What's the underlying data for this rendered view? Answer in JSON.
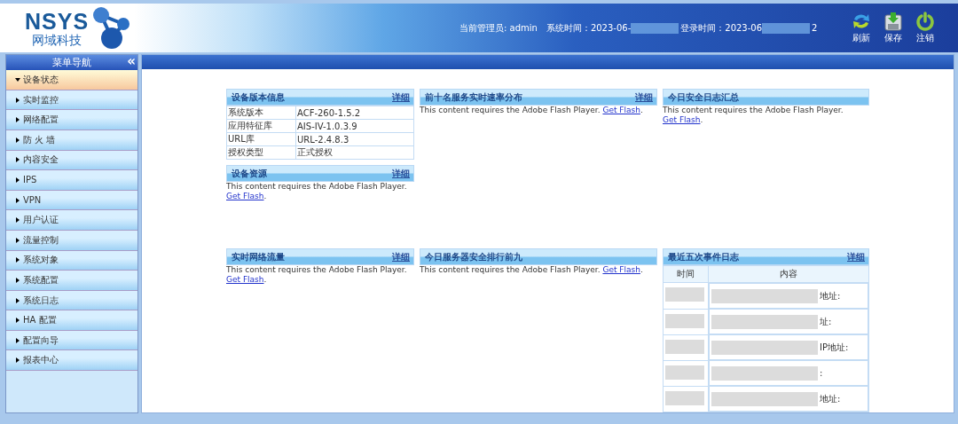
{
  "header": {
    "logo_text": "NSYS",
    "logo_subtitle": "网域科技",
    "admin": "当前管理员: admin",
    "system_time": "系统时间：2023-06-",
    "login_time": "登录时间：2023-06",
    "login_time_tail": "2",
    "actions": [
      {
        "label": "刷新",
        "kind": "refresh"
      },
      {
        "label": "保存",
        "kind": "save"
      },
      {
        "label": "注销",
        "kind": "logout"
      }
    ]
  },
  "sidebar": {
    "title": "菜单导航",
    "collapse": "«",
    "items": [
      {
        "label": "设备状态",
        "selected": true
      },
      {
        "label": "实时监控",
        "selected": false
      },
      {
        "label": "网络配置",
        "selected": false
      },
      {
        "label": "防 火 墙",
        "selected": false
      },
      {
        "label": "内容安全",
        "selected": false
      },
      {
        "label": "IPS",
        "selected": false
      },
      {
        "label": "VPN",
        "selected": false
      },
      {
        "label": "用户认证",
        "selected": false
      },
      {
        "label": "流量控制",
        "selected": false
      },
      {
        "label": "系统对象",
        "selected": false
      },
      {
        "label": "系统配置",
        "selected": false
      },
      {
        "label": "系统日志",
        "selected": false
      },
      {
        "label": "HA 配置",
        "selected": false
      },
      {
        "label": "配置向导",
        "selected": false
      },
      {
        "label": "报表中心",
        "selected": false
      }
    ]
  },
  "panel_rows": [
    [
      [
        {
          "kind": "table",
          "title": "设备版本信息",
          "detail": "详细",
          "rows": [
            [
              "系统版本",
              "ACF-260-1.5.2"
            ],
            [
              "应用特征库",
              "AIS-IV-1.0.3.9"
            ],
            [
              "URL库",
              "URL-2.4.8.3"
            ],
            [
              "授权类型",
              "正式授权"
            ]
          ]
        },
        {
          "kind": "flash",
          "title": "设备资源",
          "detail": "详细",
          "message": "This content requires the Adobe Flash Player.",
          "link": "Get Flash",
          "suffix": "."
        }
      ],
      [
        {
          "kind": "flash",
          "title": "前十名服务实时速率分布",
          "detail": "详细",
          "message": "This content requires the Adobe Flash Player.",
          "link": "Get Flash",
          "suffix": "."
        }
      ],
      [
        {
          "kind": "flash",
          "title": "今日安全日志汇总",
          "message": "This content requires the Adobe Flash Player.",
          "link": "Get Flash",
          "suffix": "."
        }
      ]
    ],
    [
      [
        {
          "kind": "flash",
          "title": "实时网络流量",
          "detail": "详细",
          "message": "This content requires the Adobe Flash Player.",
          "link": "Get Flash",
          "suffix": "."
        }
      ],
      [
        {
          "kind": "flash",
          "title": "今日服务器安全排行前九",
          "message": "This content requires the Adobe Flash Player.",
          "link": "Get Flash",
          "suffix": "."
        }
      ],
      [
        {
          "kind": "events",
          "title": "最近五次事件日志",
          "detail": "详细",
          "columns": [
            "时间",
            "内容"
          ],
          "rows": [
            {
              "content": "地址:"
            },
            {
              "content": "址:"
            },
            {
              "content": "IP地址:"
            },
            {
              "content": ":"
            },
            {
              "content": "地址:"
            }
          ]
        }
      ]
    ]
  ]
}
